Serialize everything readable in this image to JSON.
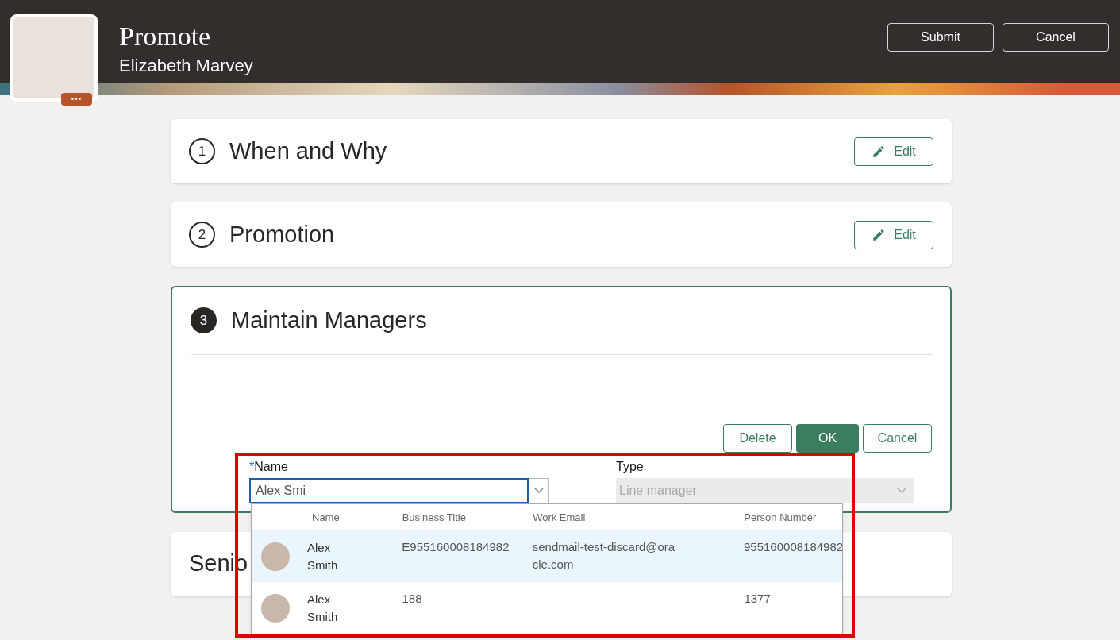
{
  "header": {
    "title": "Promote",
    "subtitle": "Elizabeth Marvey",
    "more_badge": "•••",
    "buttons": [
      "Submit",
      "Cancel"
    ]
  },
  "sections": [
    {
      "number": "1",
      "title": "When and Why",
      "active": false,
      "edit_label": "Edit"
    },
    {
      "number": "2",
      "title": "Promotion",
      "active": false,
      "edit_label": "Edit"
    },
    {
      "number": "3",
      "title": "Maintain Managers",
      "active": true,
      "actions": [
        "Delete",
        "OK",
        "Cancel"
      ],
      "form": {
        "name_label": "Name",
        "name_required": true,
        "required_mark": "*",
        "name_value": "Alex Smi",
        "type_label": "Type",
        "type_value": "Line manager",
        "type_disabled": true
      }
    },
    {
      "title": "Senio",
      "active": false
    }
  ],
  "dropdown": {
    "columns": [
      "Name",
      "Business Title",
      "Work Email",
      "Person Number"
    ],
    "rows": [
      {
        "name": "Alex Smith",
        "title": "E955160008184982",
        "email": "sendmail-test-discard@oracle.com",
        "number": "955160008184982",
        "selected": true
      },
      {
        "name": "Alex Smith",
        "title": "188",
        "email": "",
        "number": "1377",
        "selected": false
      }
    ]
  }
}
